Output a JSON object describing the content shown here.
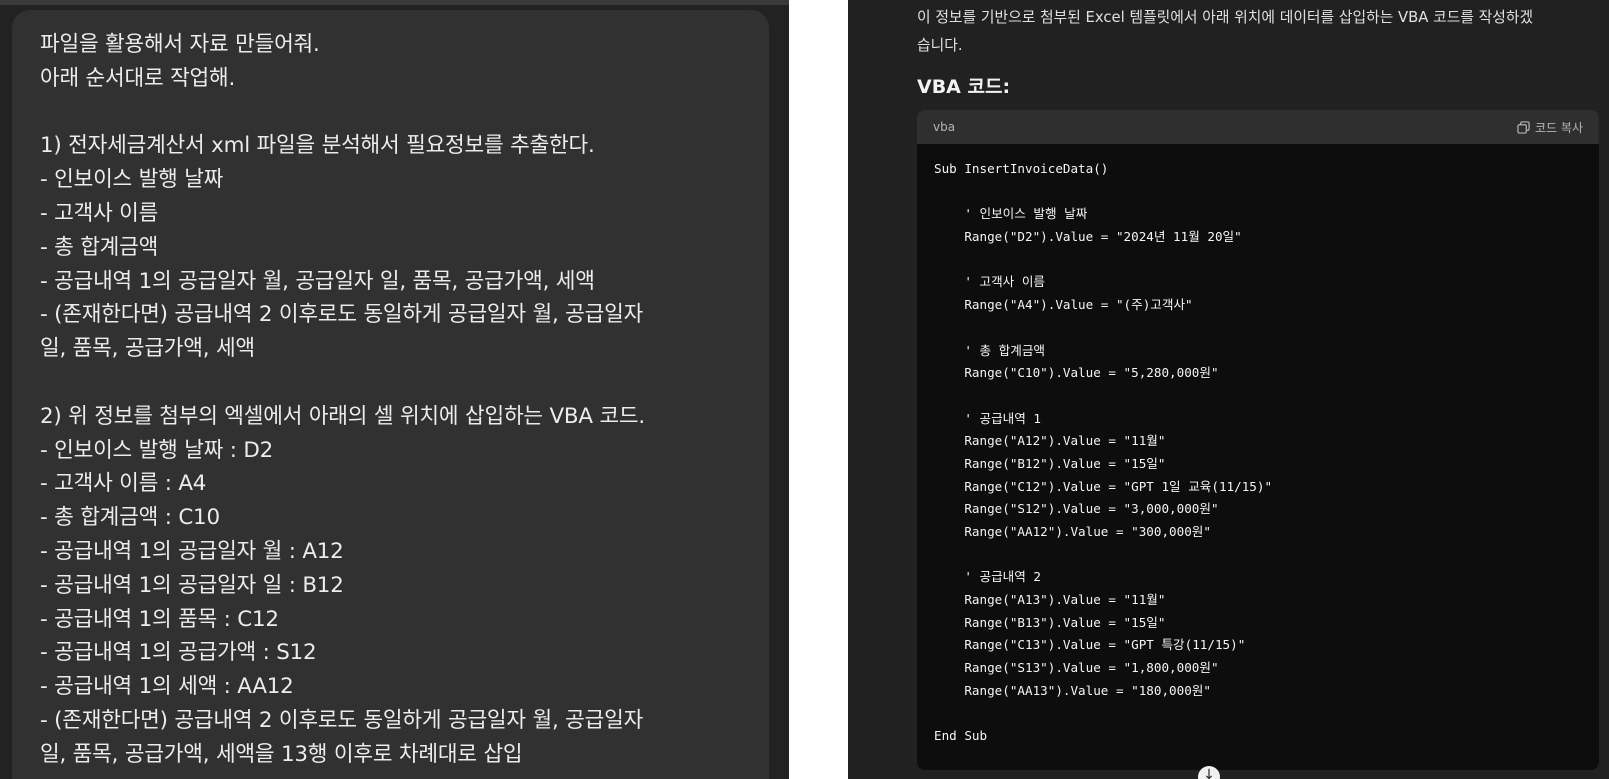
{
  "left": {
    "message_lines": [
      "파일을 활용해서 자료 만들어줘.",
      "아래 순서대로 작업해.",
      "",
      "1) 전자세금계산서 xml 파일을 분석해서 필요정보를 추출한다.",
      "- 인보이스 발행 날짜",
      "- 고객사 이름",
      "- 총 합계금액",
      "- 공급내역 1의 공급일자 월, 공급일자 일, 품목, 공급가액, 세액",
      "- (존재한다면) 공급내역 2 이후로도 동일하게 공급일자 월, 공급일자",
      "일, 품목, 공급가액, 세액",
      "",
      "2) 위 정보를 첨부의 엑셀에서 아래의 셀 위치에 삽입하는 VBA 코드.",
      "- 인보이스 발행 날짜 : D2",
      "- 고객사 이름 : A4",
      "- 총 합계금액 : C10",
      "- 공급내역 1의 공급일자 월 : A12",
      "- 공급내역 1의 공급일자 일 : B12",
      "- 공급내역 1의 품목 : C12",
      "- 공급내역 1의 공급가액 : S12",
      "- 공급내역 1의 세액 : AA12",
      "- (존재한다면) 공급내역 2 이후로도 동일하게 공급일자 월, 공급일자",
      "일, 품목, 공급가액, 세액을 13행 이후로 차례대로 삽입"
    ]
  },
  "right": {
    "intro_lines": [
      "이 정보를 기반으로 첨부된 Excel 템플릿에서 아래 위치에 데이터를 삽입하는 VBA 코드를 작성하겠",
      "습니다."
    ],
    "heading": "VBA 코드:",
    "code_block": {
      "language": "vba",
      "copy_label": "코드 복사",
      "lines": [
        "Sub InsertInvoiceData()",
        "",
        "    ' 인보이스 발행 날짜",
        "    Range(\"D2\").Value = \"2024년 11월 20일\"",
        "",
        "    ' 고객사 이름",
        "    Range(\"A4\").Value = \"(주)고객사\"",
        "",
        "    ' 총 합계금액",
        "    Range(\"C10\").Value = \"5,280,000원\"",
        "",
        "    ' 공급내역 1",
        "    Range(\"A12\").Value = \"11월\"",
        "    Range(\"B12\").Value = \"15일\"",
        "    Range(\"C12\").Value = \"GPT 1일 교육(11/15)\"",
        "    Range(\"S12\").Value = \"3,000,000원\"",
        "    Range(\"AA12\").Value = \"300,000원\"",
        "",
        "    ' 공급내역 2",
        "    Range(\"A13\").Value = \"11월\"",
        "    Range(\"B13\").Value = \"15일\"",
        "    Range(\"C13\").Value = \"GPT 특강(11/15)\"",
        "    Range(\"S13\").Value = \"1,800,000원\"",
        "    Range(\"AA13\").Value = \"180,000원\"",
        "",
        "End Sub"
      ]
    },
    "scroll_icon": "arrow-down-icon",
    "scroll_glyph": "↓"
  },
  "colors": {
    "left_background": "#222222",
    "bubble_background": "#313131",
    "right_background": "#212121",
    "code_background": "#0d0d0d",
    "code_header_background": "#2f2f2f",
    "text": "#ececec"
  }
}
